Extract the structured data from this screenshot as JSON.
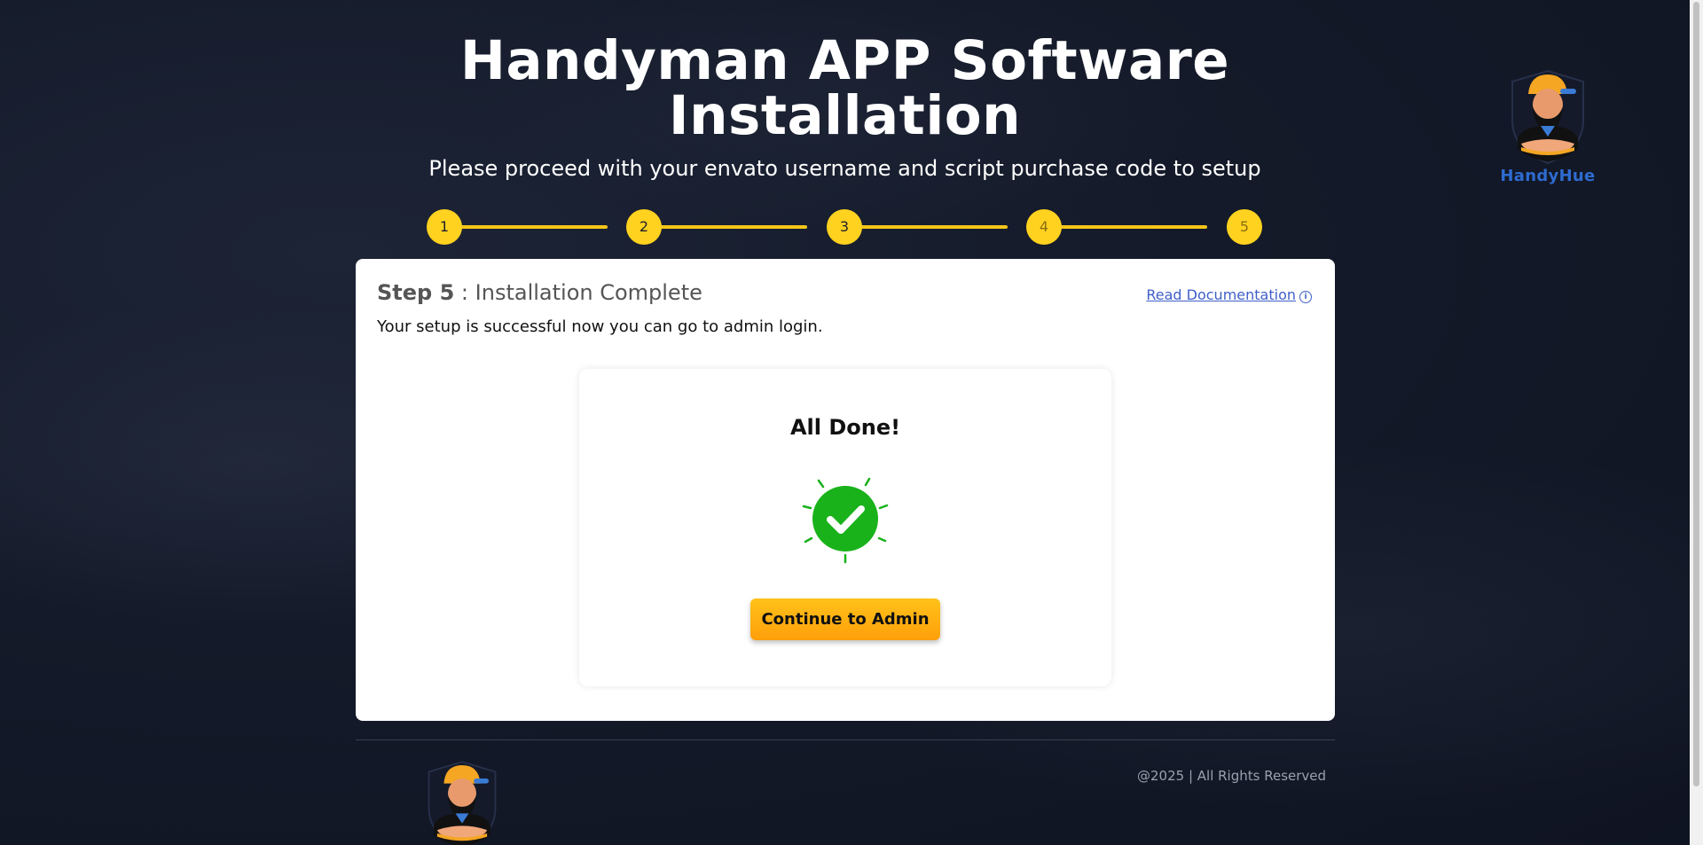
{
  "header": {
    "title_line1": "Handyman APP Software",
    "title_line2": "Installation",
    "subtitle": "Please proceed with your envato username and script purchase code to setup"
  },
  "brand": {
    "name": "HandyHue",
    "logo_icon": "handyman-mascot-icon"
  },
  "stepper": {
    "steps": [
      "1",
      "2",
      "3",
      "4",
      "5"
    ],
    "current": 5,
    "accent_color": "#ffd21f"
  },
  "card": {
    "step_label": "Step 5",
    "step_separator": ":",
    "step_title": "Installation Complete",
    "doc_link": "Read Documentation",
    "description": "Your setup is successful now you can go to admin login."
  },
  "done": {
    "title": "All Done!",
    "icon": "success-check-icon",
    "button_label": "Continue to Admin",
    "success_color": "#19b21b"
  },
  "footer": {
    "copyright": "@2025 | All Rights Reserved"
  }
}
